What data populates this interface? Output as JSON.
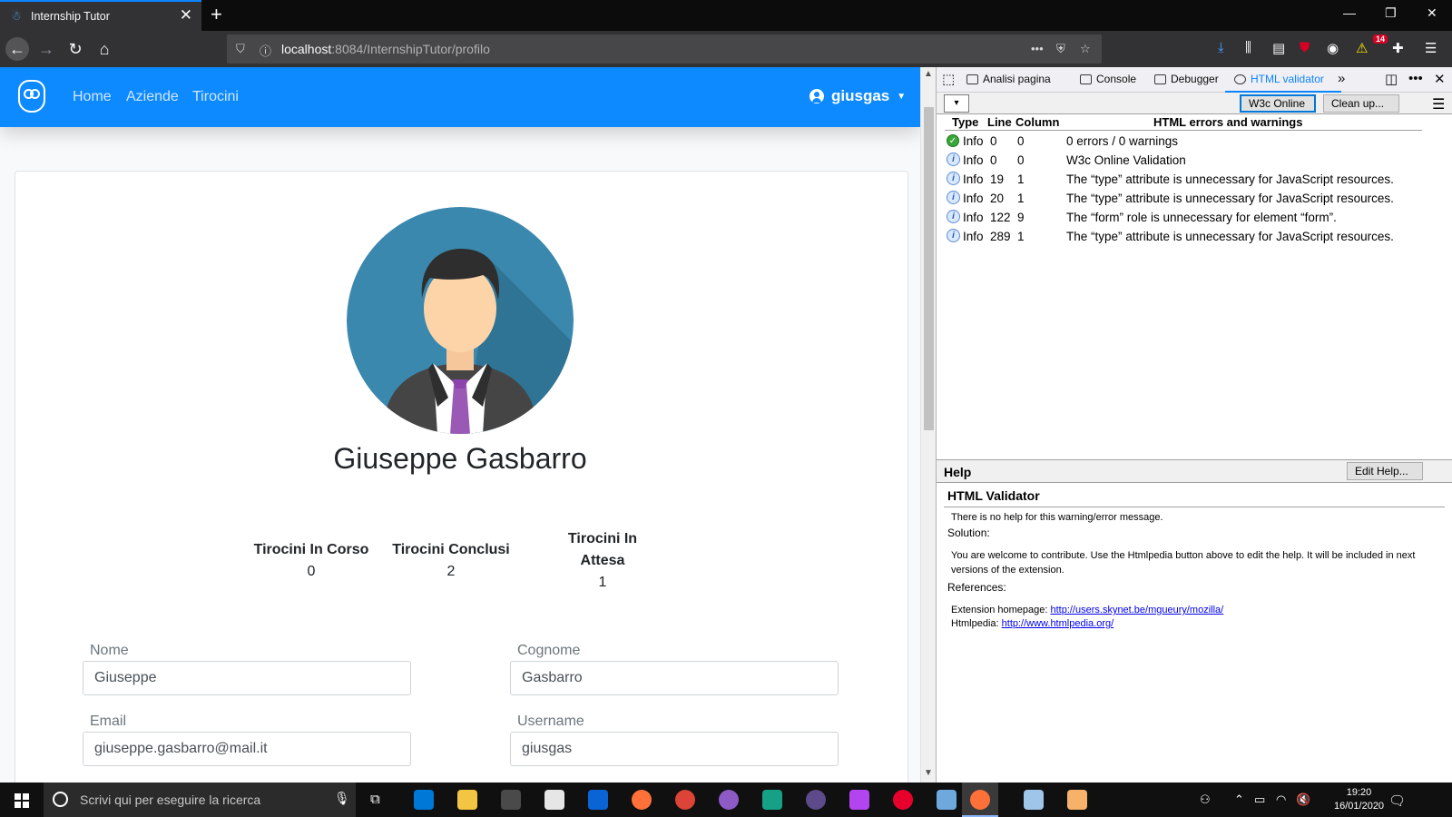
{
  "browser": {
    "tab_title": "Internship Tutor",
    "url_host": "localhost",
    "url_rest": ":8084/InternshipTutor/profilo",
    "notification_count": "14"
  },
  "app": {
    "nav": {
      "home": "Home",
      "aziende": "Aziende",
      "tirocini": "Tirocini",
      "user": "giusgas"
    },
    "profile": {
      "full_name": "Giuseppe Gasbarro",
      "stats": [
        {
          "label": "Tirocini In Corso",
          "value": "0"
        },
        {
          "label": "Tirocini Conclusi",
          "value": "2"
        },
        {
          "label": "Tirocini In Attesa",
          "value": "1"
        }
      ],
      "fields": {
        "nome": {
          "label": "Nome",
          "value": "Giuseppe"
        },
        "cognome": {
          "label": "Cognome",
          "value": "Gasbarro"
        },
        "email": {
          "label": "Email",
          "value": "giuseppe.gasbarro@mail.it"
        },
        "username": {
          "label": "Username",
          "value": "giusgas"
        }
      }
    },
    "brand_color": "#0d8aff"
  },
  "devtools": {
    "tabs": [
      "Analisi pagina",
      "Console",
      "Debugger",
      "HTML validator"
    ],
    "selected_tab": "HTML validator",
    "toolbar": {
      "w3c": "W3c Online",
      "cleanup": "Clean up..."
    },
    "table": {
      "headers": {
        "type": "Type",
        "line": "Line",
        "column": "Column",
        "message": "HTML errors and warnings"
      },
      "rows": [
        {
          "icon": "check-icon",
          "type": "Info",
          "line": "0",
          "column": "0",
          "message": "0 errors / 0 warnings"
        },
        {
          "icon": "info-icon",
          "type": "Info",
          "line": "0",
          "column": "0",
          "message": "W3c Online Validation"
        },
        {
          "icon": "info-icon",
          "type": "Info",
          "line": "19",
          "column": "1",
          "message": "The “type” attribute is unnecessary for JavaScript resources."
        },
        {
          "icon": "info-icon",
          "type": "Info",
          "line": "20",
          "column": "1",
          "message": "The “type” attribute is unnecessary for JavaScript resources."
        },
        {
          "icon": "info-icon",
          "type": "Info",
          "line": "122",
          "column": "9",
          "message": "The “form” role is unnecessary for element “form”."
        },
        {
          "icon": "info-icon",
          "type": "Info",
          "line": "289",
          "column": "1",
          "message": "The “type” attribute is unnecessary for JavaScript resources."
        }
      ]
    },
    "help": {
      "title": "Help",
      "edit_button": "Edit Help...",
      "section_title": "HTML Validator",
      "no_help": "There is no help for this warning/error message.",
      "solution_label": "Solution:",
      "solution_text": "You are welcome to contribute. Use the Htmlpedia button above to edit the help. It will be included in next versions of the extension.",
      "references_label": "References:",
      "ext_label": "Extension homepage: ",
      "ext_link": "http://users.skynet.be/mgueury/mozilla/",
      "htmlpedia_label": "Htmlpedia: ",
      "htmlpedia_link": "http://www.htmlpedia.org/"
    }
  },
  "taskbar": {
    "search_placeholder": "Scrivi qui per eseguire la ricerca",
    "time": "19:20",
    "date": "16/01/2020"
  }
}
